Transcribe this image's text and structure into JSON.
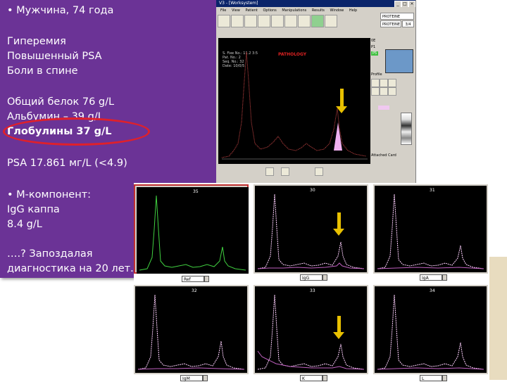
{
  "slide": {
    "lines": [
      "• Мужчина, 74 года",
      "Гиперемия",
      "Повышенный PSA",
      "Боли в спине",
      "Общий белок 76 g/L",
      "Альбумин – 39 g/L",
      "Глобулины 37 g/L",
      "PSA 17.861 мг/L (<4.9)",
      "• M-компонент:",
      "IgG каппа",
      "8.4 g/L",
      "….? Запоздалая",
      "диагностика на 20 лет."
    ]
  },
  "app": {
    "title": "V3 - [Worksystem]",
    "menu": [
      "File",
      "View",
      "Patient",
      "Options",
      "Manipulations",
      "Results",
      "Window",
      "Help"
    ],
    "right_labels": [
      "PROTEINE",
      "PROTEINE"
    ],
    "right_value": "3/4",
    "patient_info": [
      "S. Fixe No.: 11.2 3:5",
      "Pat. No.: 2",
      "Seq. No.: 32",
      "Date: 10/0/5"
    ],
    "graph_label": "PATHOLOGY",
    "side_labels": [
      "Profile",
      "Attached Card"
    ],
    "side_codes": [
      "0E",
      "P1",
      "P5"
    ]
  },
  "grid": {
    "cells": [
      {
        "number": "35",
        "select": "Ref"
      },
      {
        "number": "30",
        "select": "IgG"
      },
      {
        "number": "31",
        "select": "IgA"
      },
      {
        "number": "32",
        "select": "IgM"
      },
      {
        "number": "33",
        "select": "K"
      },
      {
        "number": "34",
        "select": "L"
      }
    ]
  },
  "colors": {
    "panel_purple": "#6b3396",
    "highlight_red": "#e0202a",
    "arrow_yellow": "#e8c000",
    "trace_red": "#d04848",
    "trace_green": "#40d040",
    "trace_pink": "#ffd0ff"
  }
}
